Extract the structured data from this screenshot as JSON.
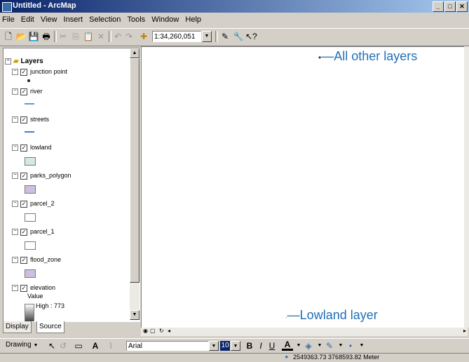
{
  "window": {
    "title": "Untitled - ArcMap",
    "buttons": {
      "minimize": "_",
      "maximize": "□",
      "close": "✕"
    }
  },
  "menu": [
    "File",
    "Edit",
    "View",
    "Insert",
    "Selection",
    "Tools",
    "Window",
    "Help"
  ],
  "toolbar": {
    "scale": "1:34,260,051"
  },
  "toc": {
    "root": "Layers",
    "layers": [
      {
        "name": "junction point"
      },
      {
        "name": "river"
      },
      {
        "name": "streets"
      },
      {
        "name": "lowland"
      },
      {
        "name": "parks_polygon"
      },
      {
        "name": "parcel_2"
      },
      {
        "name": "parcel_1"
      },
      {
        "name": "flood_zone"
      },
      {
        "name": "elevation"
      }
    ],
    "elevation_legend": {
      "heading": "Value",
      "high": "High : 773"
    },
    "tabs": [
      "Display",
      "Source"
    ]
  },
  "map": {
    "callouts": {
      "all_other": "All other layers",
      "lowland": "Lowland layer"
    }
  },
  "drawing_toolbar": {
    "drawing_label": "Drawing",
    "font": "Arial",
    "size": "10",
    "bold": "B",
    "italic": "I",
    "underline": "U",
    "font_color_label": "A"
  },
  "status": {
    "coordinates": "2549363.73  3768593.82 Meter"
  },
  "colors": {
    "title_start": "#0a246a",
    "title_end": "#a6caf0",
    "callout": "#1f6fb6",
    "lowland_fill": "#d4eadc",
    "polygon_fill": "#cdbfe0",
    "river_line": "#5a9ad6"
  }
}
